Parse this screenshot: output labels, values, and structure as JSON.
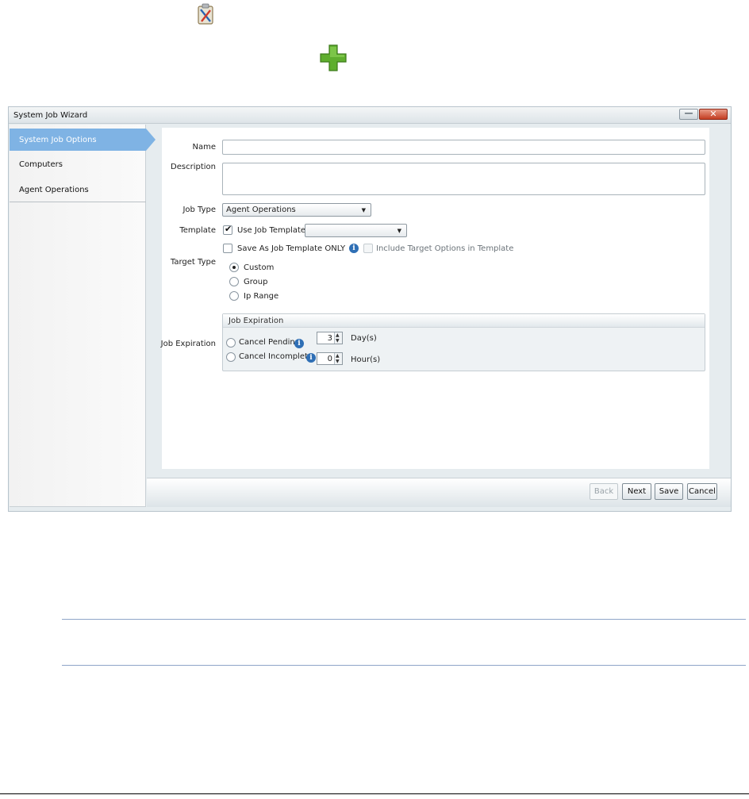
{
  "toolbar": {
    "icons": [
      "clipboard-tools-icon",
      "add-plus-icon"
    ]
  },
  "window": {
    "title": "System Job Wizard"
  },
  "sidebar": {
    "items": [
      {
        "label": "System Job Options",
        "active": true
      },
      {
        "label": "Computers",
        "active": false
      },
      {
        "label": "Agent Operations",
        "active": false
      }
    ]
  },
  "form": {
    "name_label": "Name",
    "name_value": "",
    "description_label": "Description",
    "description_value": "",
    "job_type_label": "Job Type",
    "job_type_value": "Agent Operations",
    "template_label": "Template",
    "use_job_template_label": "Use Job Template",
    "use_job_template_checked": true,
    "template_value": "",
    "save_as_template_only_label": "Save As Job Template ONLY",
    "save_as_template_only_checked": false,
    "include_target_options_label": "Include Target Options in Template",
    "include_target_options_checked": false,
    "target_type_label": "Target Type",
    "target_types": [
      {
        "label": "Custom",
        "selected": true
      },
      {
        "label": "Group",
        "selected": false
      },
      {
        "label": "Ip Range",
        "selected": false
      }
    ],
    "job_expiration_label": "Job Expiration",
    "job_expiration_group_title": "Job Expiration",
    "cancel_pending_label": "Cancel Pending",
    "cancel_pending_value": "3",
    "cancel_pending_unit": "Day(s)",
    "cancel_incomplete_label": "Cancel Incomplete",
    "cancel_incomplete_value": "0",
    "cancel_incomplete_unit": "Hour(s)"
  },
  "buttons": {
    "back": "Back",
    "next": "Next",
    "save": "Save",
    "cancel": "Cancel"
  },
  "colors": {
    "active_nav": "#7fb3e4",
    "info_icon": "#2f6fb5",
    "plus_icon": "#5fae2e",
    "close_button": "#c33d22"
  }
}
